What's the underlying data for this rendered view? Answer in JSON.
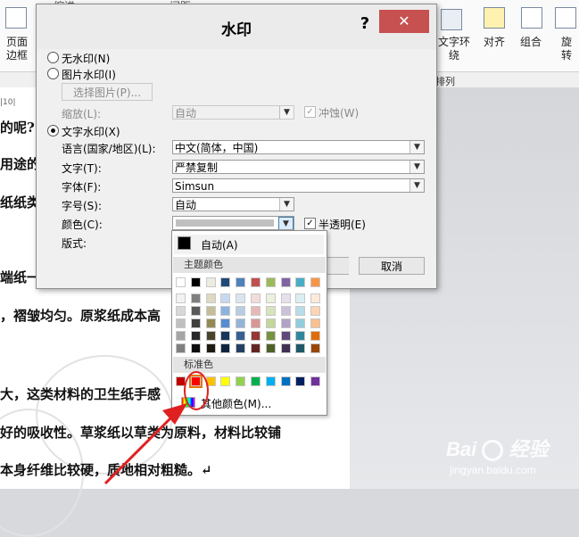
{
  "ribbon": {
    "left_items": [
      {
        "label": "页面",
        "sub": "边框",
        "icon": "page-border-icon"
      }
    ],
    "top_fragments": [
      "缩进",
      "间距"
    ],
    "right_items": [
      {
        "label": "文字环绕",
        "icon": "text-wrap-icon"
      },
      {
        "label": "对齐",
        "icon": "align-icon"
      },
      {
        "label": "组合",
        "icon": "group-icon"
      },
      {
        "label": "旋",
        "sub": "转",
        "icon": "rotate-icon"
      }
    ],
    "group_label": "排列"
  },
  "document": {
    "ruler": "|10|",
    "lines": [
      "的呢?",
      "用途的",
      "纸纸类",
      "端纸一",
      "，褶皱均匀。原浆纸成本高",
      "大，这类材料的卫生纸手感",
      "好的吸收性。草浆纸以草类为原料，材料比较铺",
      "本身纤维比较硬，质地相对粗糙。↵"
    ]
  },
  "dialog": {
    "title": "水印",
    "help": "?",
    "close": "✕",
    "no_watermark": "无水印(N)",
    "picture_watermark": "图片水印(I)",
    "select_picture": "选择图片(P)...",
    "scale_label": "缩放(L):",
    "scale_value": "自动",
    "washout": "冲蚀(W)",
    "text_watermark": "文字水印(X)",
    "language_label": "语言(国家/地区)(L):",
    "language_value": "中文(简体，中国)",
    "text_label": "文字(T):",
    "text_value": "严禁复制",
    "font_label": "字体(F):",
    "font_value": "Simsun",
    "size_label": "字号(S):",
    "size_value": "自动",
    "color_label": "颜色(C):",
    "semitransparent": "半透明(E)",
    "layout_label": "版式:",
    "cancel": "取消",
    "selected_option": "text_watermark"
  },
  "palette": {
    "auto": "自动(A)",
    "theme_header": "主题颜色",
    "standard_header": "标准色",
    "more_colors": "其他颜色(M)...",
    "theme_top": [
      "#ffffff",
      "#000000",
      "#eeece1",
      "#1f497d",
      "#4f81bd",
      "#c0504d",
      "#9bbb59",
      "#8064a2",
      "#4bacc6",
      "#f79646"
    ],
    "theme_shades": [
      [
        "#f2f2f2",
        "#d8d8d8",
        "#bfbfbf",
        "#a5a5a5",
        "#7f7f7f"
      ],
      [
        "#7f7f7f",
        "#595959",
        "#3f3f3f",
        "#262626",
        "#0c0c0c"
      ],
      [
        "#ddd9c3",
        "#c4bd97",
        "#938953",
        "#494429",
        "#1d1b10"
      ],
      [
        "#c6d9f0",
        "#8db3e2",
        "#548dd4",
        "#17365d",
        "#0f243e"
      ],
      [
        "#dbe5f1",
        "#b8cce4",
        "#95b3d7",
        "#366092",
        "#244061"
      ],
      [
        "#f2dcdb",
        "#e5b9b7",
        "#d99694",
        "#953734",
        "#632423"
      ],
      [
        "#ebf1dd",
        "#d7e3bc",
        "#c3d69b",
        "#76923c",
        "#4f6128"
      ],
      [
        "#e5e0ec",
        "#ccc1d9",
        "#b2a2c7",
        "#5f497a",
        "#3f3151"
      ],
      [
        "#dbeef3",
        "#b7dde8",
        "#92cddc",
        "#31859b",
        "#205867"
      ],
      [
        "#fdeada",
        "#fbd5b5",
        "#fac08f",
        "#e36c09",
        "#974806"
      ]
    ],
    "standard": [
      "#c00000",
      "#ff0000",
      "#ffc000",
      "#ffff00",
      "#92d050",
      "#00b050",
      "#00b0f0",
      "#0070c0",
      "#002060",
      "#7030a0"
    ],
    "selected_standard_index": 1
  },
  "watermark_logo": {
    "brand": "Bai",
    "suffix": "经验",
    "url": "jingyan.baidu.com"
  }
}
